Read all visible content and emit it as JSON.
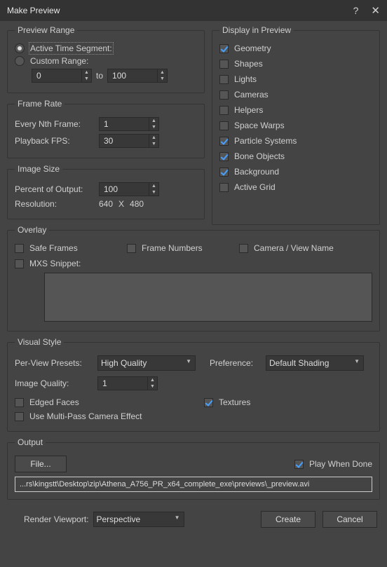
{
  "title": "Make Preview",
  "preview_range": {
    "legend": "Preview Range",
    "active_label": "Active Time Segment:",
    "custom_label": "Custom Range:",
    "from": "0",
    "to_label": "to",
    "to": "100"
  },
  "frame_rate": {
    "legend": "Frame Rate",
    "every_label": "Every Nth Frame:",
    "every_value": "1",
    "fps_label": "Playback FPS:",
    "fps_value": "30"
  },
  "image_size": {
    "legend": "Image Size",
    "percent_label": "Percent of Output:",
    "percent_value": "100",
    "res_label": "Resolution:",
    "res_w": "640",
    "res_x": "X",
    "res_h": "480"
  },
  "display_in_preview": {
    "legend": "Display in Preview",
    "items": [
      {
        "label": "Geometry",
        "checked": true
      },
      {
        "label": "Shapes",
        "checked": false
      },
      {
        "label": "Lights",
        "checked": false
      },
      {
        "label": "Cameras",
        "checked": false
      },
      {
        "label": "Helpers",
        "checked": false
      },
      {
        "label": "Space Warps",
        "checked": false
      },
      {
        "label": "Particle Systems",
        "checked": true
      },
      {
        "label": "Bone Objects",
        "checked": true
      },
      {
        "label": "Background",
        "checked": true
      },
      {
        "label": "Active Grid",
        "checked": false
      }
    ]
  },
  "overlay": {
    "legend": "Overlay",
    "safe_frames": "Safe Frames",
    "frame_numbers": "Frame Numbers",
    "camera_view": "Camera / View Name",
    "mxs_snippet": "MXS Snippet:",
    "snippet_value": ""
  },
  "visual_style": {
    "legend": "Visual Style",
    "per_view_label": "Per-View Presets:",
    "per_view_value": "High Quality",
    "preference_label": "Preference:",
    "preference_value": "Default Shading",
    "image_quality_label": "Image Quality:",
    "image_quality_value": "1",
    "edged_faces": "Edged Faces",
    "textures": "Textures",
    "multipass": "Use Multi-Pass Camera Effect"
  },
  "output": {
    "legend": "Output",
    "file_button": "File...",
    "play_when_done": "Play When Done",
    "path": "...rs\\kingstt\\Desktop\\zip\\Athena_A756_PR_x64_complete_exe\\previews\\_preview.avi"
  },
  "footer": {
    "render_viewport_label": "Render Viewport:",
    "render_viewport_value": "Perspective",
    "create": "Create",
    "cancel": "Cancel"
  }
}
